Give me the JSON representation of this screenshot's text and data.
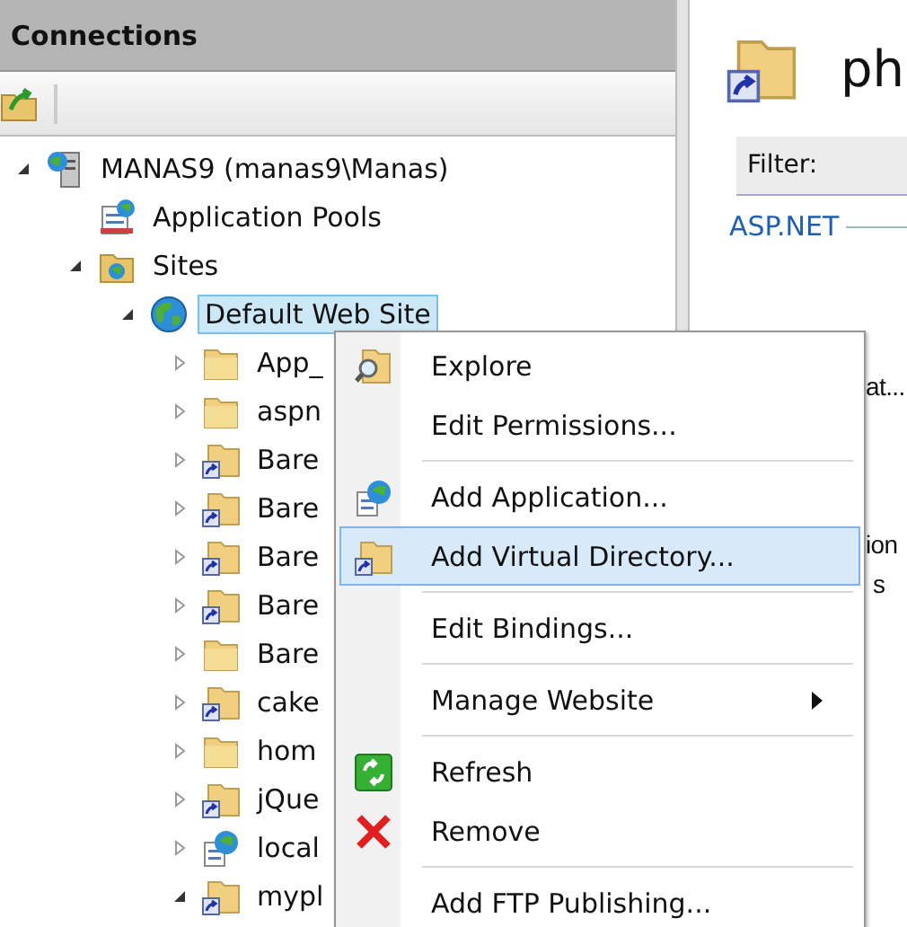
{
  "connections": {
    "title": "Connections",
    "tree": [
      {
        "label": "MANAS9 (manas9\\Manas)",
        "kind": "server",
        "expanded": true,
        "selected": false,
        "children": [
          {
            "label": "Application Pools",
            "kind": "pools",
            "selected": false
          },
          {
            "label": "Sites",
            "kind": "sites",
            "expanded": true,
            "selected": false,
            "children": [
              {
                "label": "Default Web Site",
                "kind": "site",
                "expanded": true,
                "selected": true,
                "children": [
                  {
                    "label": "App_",
                    "kind": "folder",
                    "expanded": false,
                    "selected": false
                  },
                  {
                    "label": "aspn",
                    "kind": "folder",
                    "expanded": false,
                    "selected": false
                  },
                  {
                    "label": "Bare",
                    "kind": "vdir",
                    "expanded": false,
                    "selected": false
                  },
                  {
                    "label": "Bare",
                    "kind": "vdir",
                    "expanded": false,
                    "selected": false
                  },
                  {
                    "label": "Bare",
                    "kind": "vdir",
                    "expanded": false,
                    "selected": false
                  },
                  {
                    "label": "Bare",
                    "kind": "vdir",
                    "expanded": false,
                    "selected": false
                  },
                  {
                    "label": "Bare",
                    "kind": "folder",
                    "expanded": false,
                    "selected": false
                  },
                  {
                    "label": "cake",
                    "kind": "vdir",
                    "expanded": false,
                    "selected": false
                  },
                  {
                    "label": "hom",
                    "kind": "folder",
                    "expanded": false,
                    "selected": false
                  },
                  {
                    "label": "jQue",
                    "kind": "vdir",
                    "expanded": false,
                    "selected": false
                  },
                  {
                    "label": "local",
                    "kind": "app",
                    "expanded": false,
                    "selected": false
                  },
                  {
                    "label": "mypl",
                    "kind": "vdir",
                    "expanded": true,
                    "selected": false
                  }
                ]
              }
            ]
          }
        ]
      }
    ]
  },
  "content": {
    "title": "ph",
    "filter_label": "Filter:",
    "group": "ASP.NET",
    "fragments": [
      "at...",
      "ion",
      "s"
    ]
  },
  "context_menu": [
    {
      "kind": "explore",
      "label": "Explore",
      "selected": false
    },
    {
      "kind": "plain",
      "label": "Edit Permissions...",
      "selected": false
    },
    {
      "kind": "separator"
    },
    {
      "kind": "app",
      "label": "Add Application...",
      "selected": false
    },
    {
      "kind": "vdir",
      "label": "Add Virtual Directory...",
      "selected": true
    },
    {
      "kind": "separator"
    },
    {
      "kind": "plain",
      "label": "Edit Bindings...",
      "selected": false
    },
    {
      "kind": "separator"
    },
    {
      "kind": "submenu",
      "label": "Manage Website",
      "selected": false
    },
    {
      "kind": "separator"
    },
    {
      "kind": "refresh",
      "label": "Refresh",
      "selected": false
    },
    {
      "kind": "remove",
      "label": "Remove",
      "selected": false
    },
    {
      "kind": "separator"
    },
    {
      "kind": "plain",
      "label": "Add FTP Publishing...",
      "selected": false
    }
  ]
}
